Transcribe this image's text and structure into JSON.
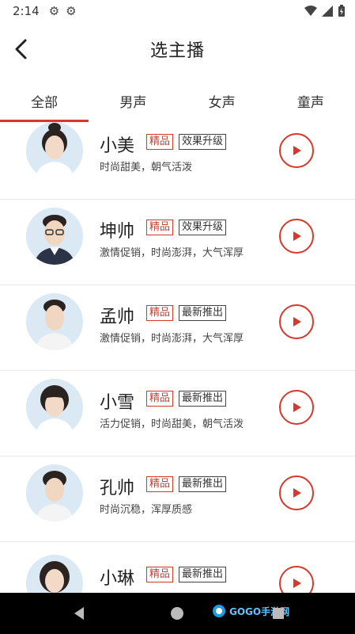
{
  "status": {
    "time": "2:14"
  },
  "header": {
    "title": "选主播"
  },
  "tabs": [
    {
      "label": "全部"
    },
    {
      "label": "男声"
    },
    {
      "label": "女声"
    },
    {
      "label": "童声"
    }
  ],
  "anchors": [
    {
      "name": "小美",
      "tag1": "精品",
      "tag2": "效果升级",
      "desc": "时尚甜美，朝气活泼"
    },
    {
      "name": "坤帅",
      "tag1": "精品",
      "tag2": "效果升级",
      "desc": "激情促销，时尚澎湃，大气浑厚"
    },
    {
      "name": "孟帅",
      "tag1": "精品",
      "tag2": "最新推出",
      "desc": "激情促销，时尚澎湃，大气浑厚"
    },
    {
      "name": "小雪",
      "tag1": "精品",
      "tag2": "最新推出",
      "desc": "活力促销，时尚甜美，朝气活泼"
    },
    {
      "name": "孔帅",
      "tag1": "精品",
      "tag2": "最新推出",
      "desc": "时尚沉稳，浑厚质感"
    },
    {
      "name": "小琳",
      "tag1": "精品",
      "tag2": "最新推出",
      "desc": ""
    }
  ],
  "watermark": {
    "text": "GOGO手游网"
  }
}
